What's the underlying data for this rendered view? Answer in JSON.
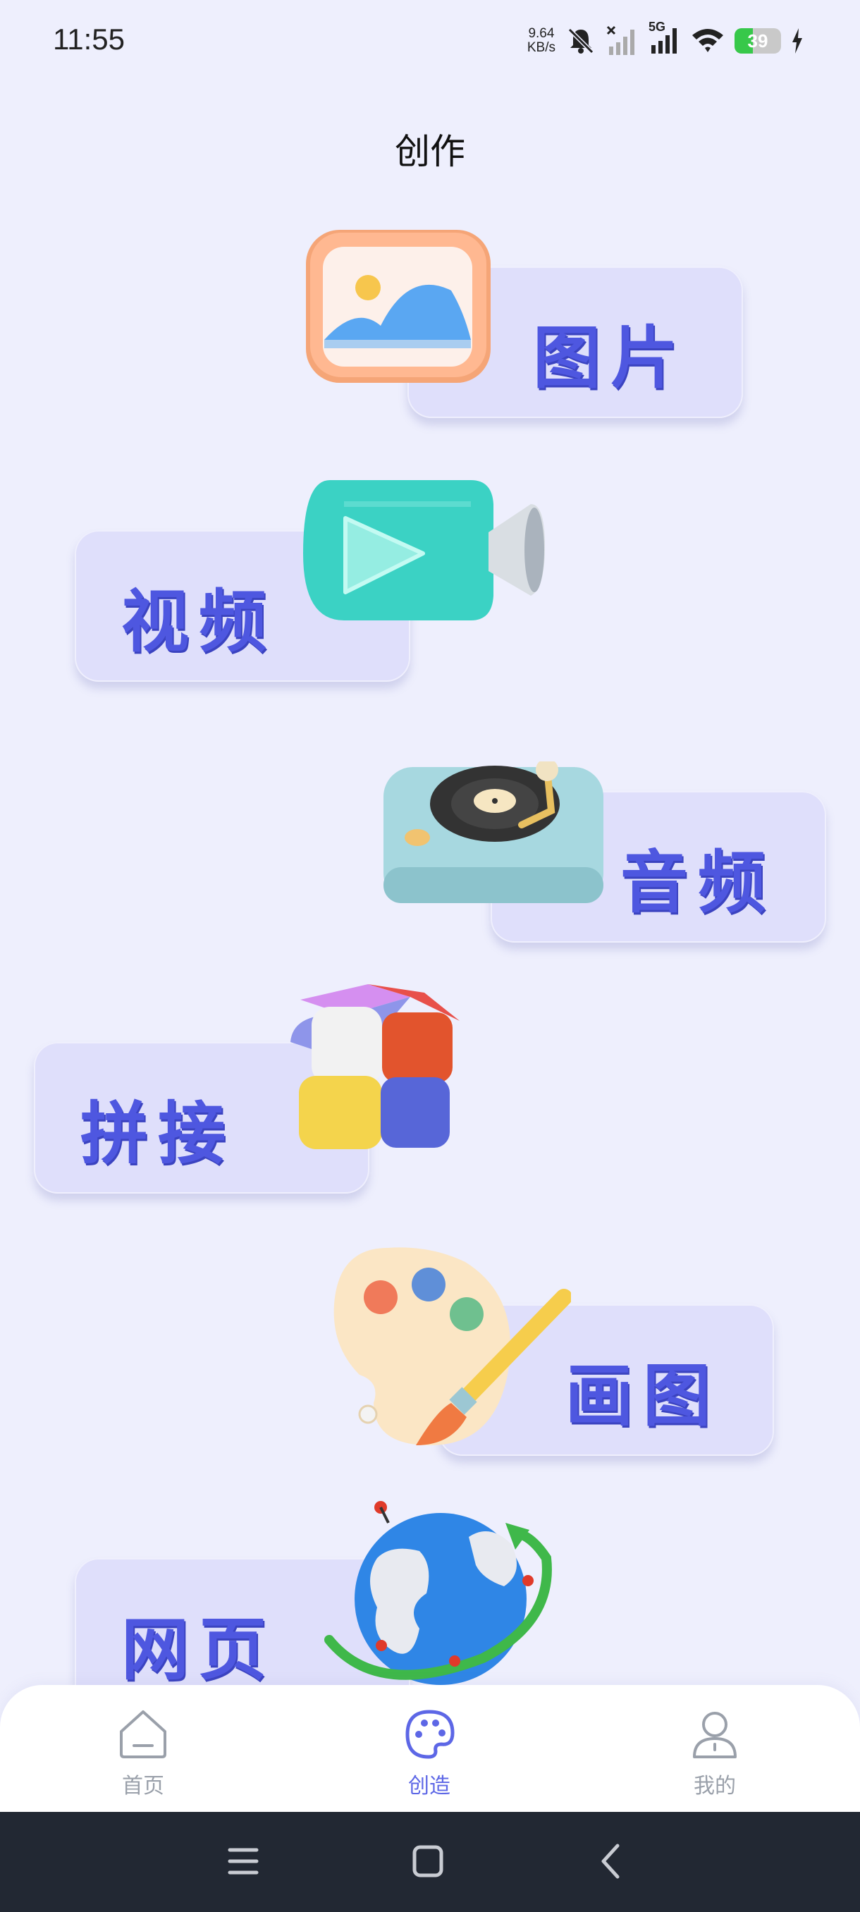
{
  "status_bar": {
    "time": "11:55",
    "net_speed_value": "9.64",
    "net_speed_unit": "KB/s",
    "network_type": "5G",
    "battery_level": "39",
    "battery_fraction": 0.39
  },
  "header": {
    "title": "创作"
  },
  "cards": [
    {
      "label": "图片",
      "icon": "image-icon"
    },
    {
      "label": "视频",
      "icon": "video-camera-icon"
    },
    {
      "label": "音频",
      "icon": "turntable-icon"
    },
    {
      "label": "拼接",
      "icon": "blocks-icon"
    },
    {
      "label": "画图",
      "icon": "palette-icon"
    },
    {
      "label": "网页",
      "icon": "globe-icon"
    }
  ],
  "bottom_nav": {
    "items": [
      {
        "label": "首页",
        "icon": "home-icon"
      },
      {
        "label": "创造",
        "icon": "palette-icon"
      },
      {
        "label": "我的",
        "icon": "profile-icon"
      }
    ],
    "active_index": 1
  },
  "colors": {
    "background": "#eeeffd",
    "card": "#dfdffb",
    "accent": "#4e57e0",
    "nav_active": "#5d67e6",
    "nav_inactive": "#9aa0aa",
    "system_bar": "#222833"
  },
  "system_nav": {
    "icons": [
      "menu-icon",
      "home-square-icon",
      "back-icon"
    ]
  }
}
